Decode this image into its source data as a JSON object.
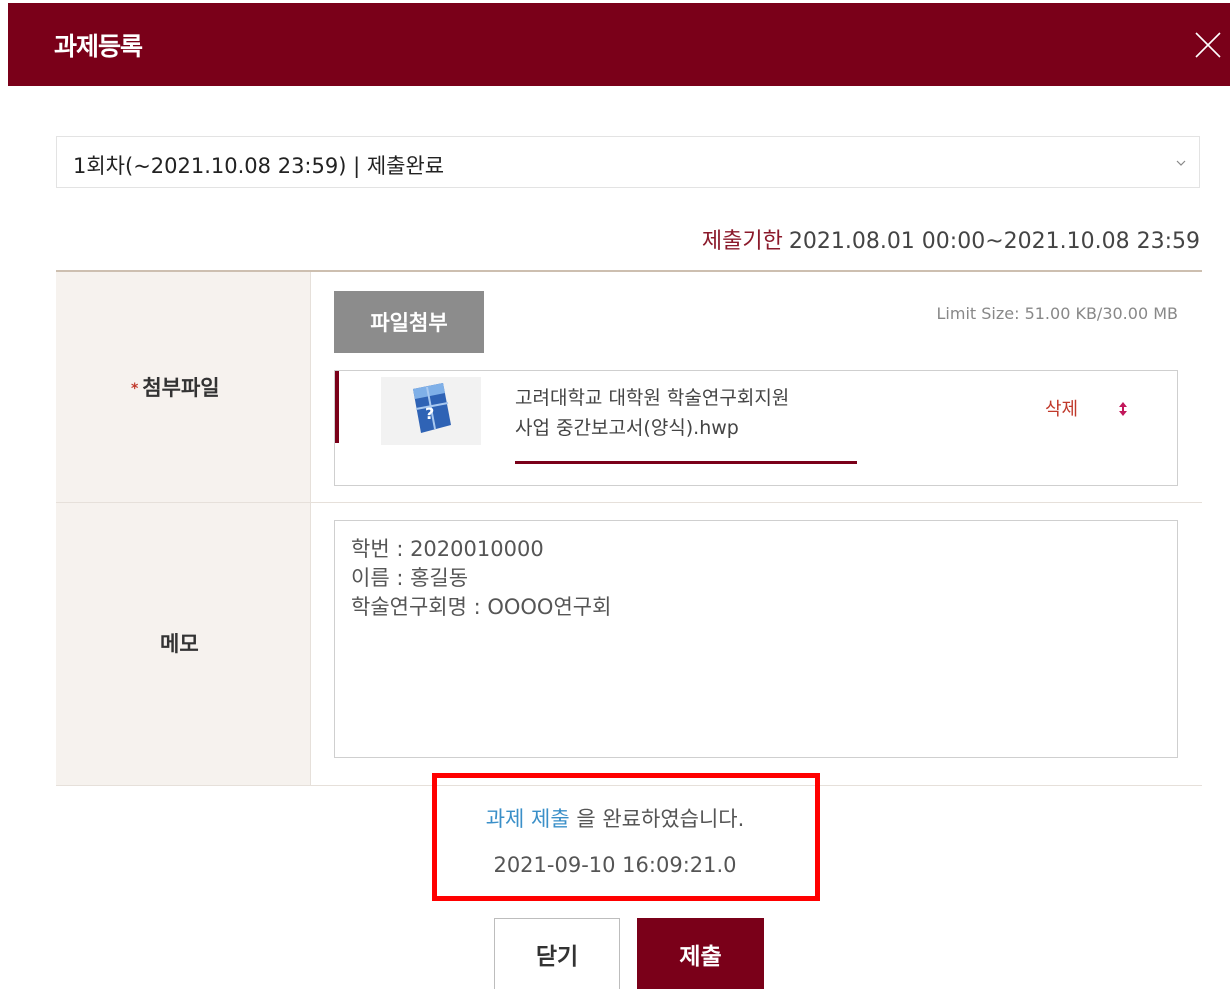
{
  "header": {
    "title": "과제등록",
    "close_icon": "close-icon"
  },
  "round_select": {
    "value": "1회차(~2021.10.08 23:59) | 제출완료",
    "icon": "chevron-down-icon"
  },
  "deadline": {
    "label": "제출기한",
    "value": "2021.08.01 00:00~2021.10.08 23:59"
  },
  "attachment": {
    "required_mark": "*",
    "label": "첨부파일",
    "attach_button": "파일첨부",
    "limit_size": "Limit Size: 51.00 KB/30.00 MB",
    "file": {
      "name_line1": "고려대학교 대학원 학술연구회지원",
      "name_line2": "사업 중간보고서(양식).hwp",
      "delete_label": "삭제",
      "thumb_icon": "hwp-file-icon",
      "move_icon": "sort-handle-icon",
      "upload_progress": 1.0
    }
  },
  "memo": {
    "label": "메모",
    "lines": [
      "학번 : 2020010000",
      "이름 : 홍길동",
      "학술연구회명 : OOOO연구회"
    ]
  },
  "status": {
    "link_text": "과제 제출",
    "message": " 을 완료하였습니다.",
    "timestamp": "2021-09-10 16:09:21.0"
  },
  "buttons": {
    "close": "닫기",
    "submit": "제출"
  },
  "colors": {
    "brand": "#7a0019",
    "link": "#3a8fc8",
    "highlight": "#ff0000",
    "accent_text": "#8b1a2b"
  }
}
